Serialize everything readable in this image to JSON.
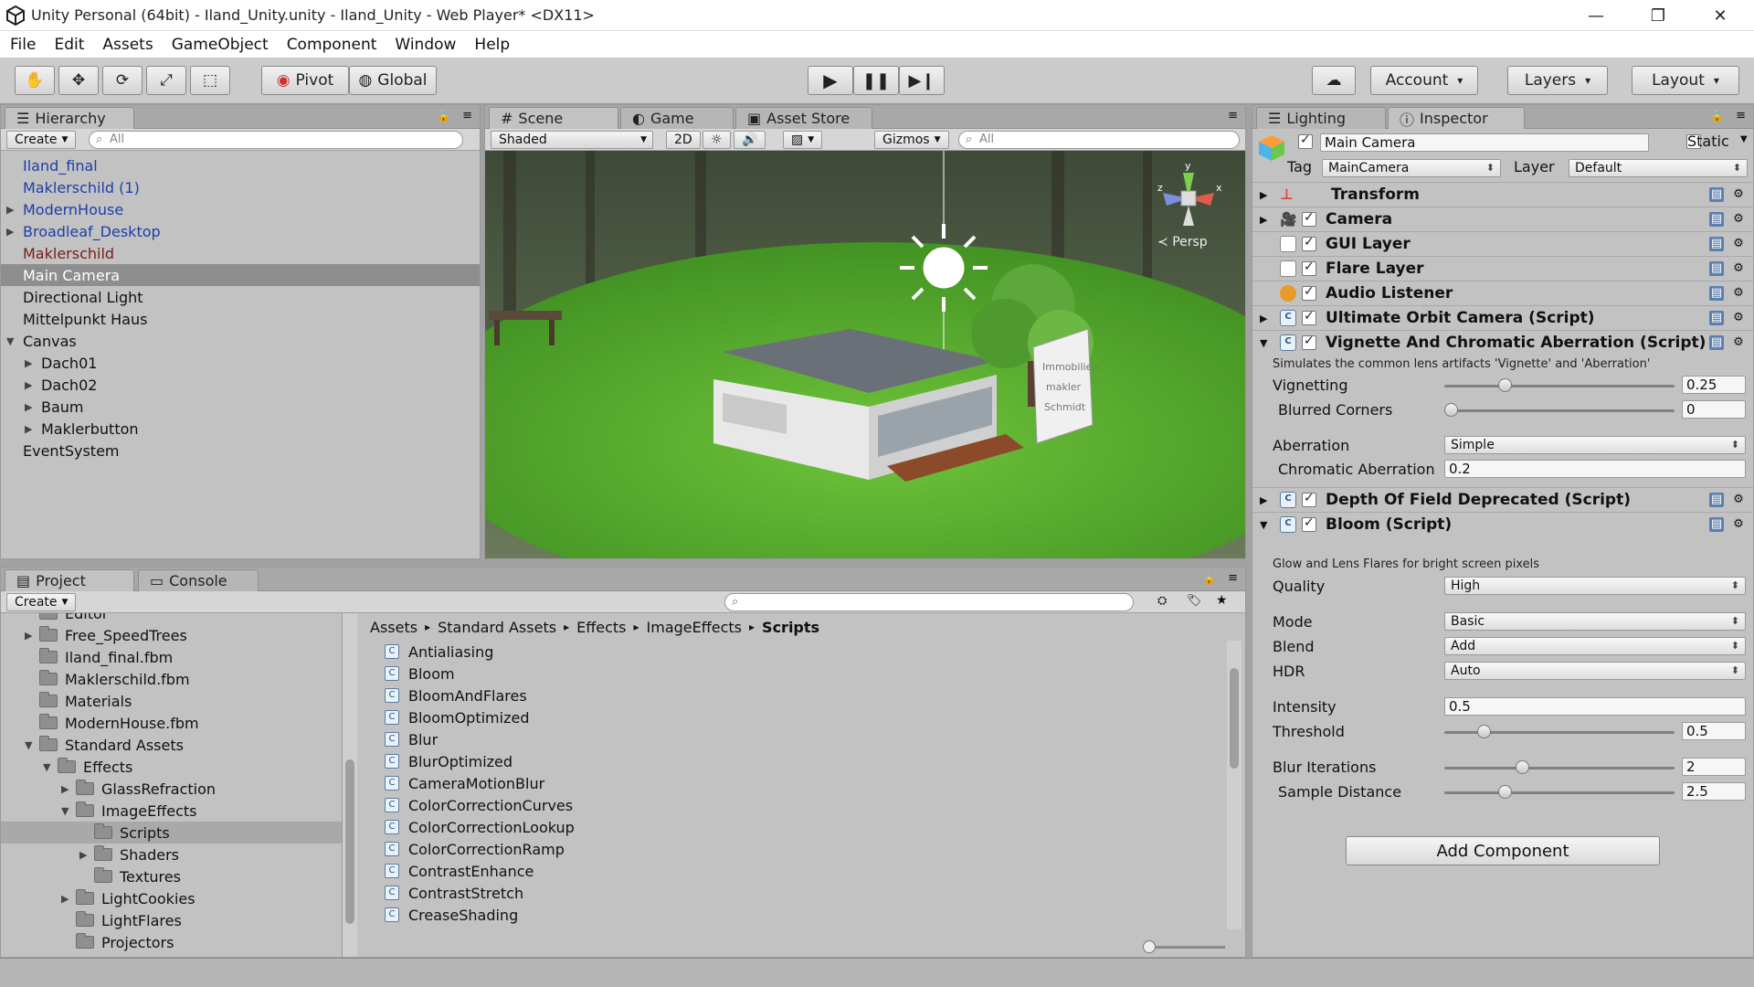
{
  "window": {
    "title": "Unity Personal (64bit) - Iland_Unity.unity - Iland_Unity - Web Player* <DX11>",
    "minimize": "—",
    "maximize": "❐",
    "close": "✕"
  },
  "menu": [
    "File",
    "Edit",
    "Assets",
    "GameObject",
    "Component",
    "Window",
    "Help"
  ],
  "toolbar": {
    "pivot": "Pivot",
    "global": "Global",
    "account": "Account",
    "layers": "Layers",
    "layout": "Layout"
  },
  "hierarchy": {
    "tab": "Hierarchy",
    "create": "Create",
    "search_placeholder": "All",
    "items": [
      {
        "label": "Iland_final",
        "style": "blue",
        "indent": 0,
        "expander": ""
      },
      {
        "label": "Maklerschild (1)",
        "style": "blue",
        "indent": 0,
        "expander": ""
      },
      {
        "label": "ModernHouse",
        "style": "blue",
        "indent": 0,
        "expander": "▶"
      },
      {
        "label": "Broadleaf_Desktop",
        "style": "blue",
        "indent": 0,
        "expander": "▶"
      },
      {
        "label": "Maklerschild",
        "style": "red",
        "indent": 0,
        "expander": ""
      },
      {
        "label": "Main Camera",
        "style": "sel",
        "indent": 0,
        "expander": ""
      },
      {
        "label": "Directional Light",
        "style": "",
        "indent": 0,
        "expander": ""
      },
      {
        "label": "Mittelpunkt Haus",
        "style": "",
        "indent": 0,
        "expander": ""
      },
      {
        "label": "Canvas",
        "style": "",
        "indent": 0,
        "expander": "▼"
      },
      {
        "label": "Dach01",
        "style": "",
        "indent": 1,
        "expander": "▶"
      },
      {
        "label": "Dach02",
        "style": "",
        "indent": 1,
        "expander": "▶"
      },
      {
        "label": "Baum",
        "style": "",
        "indent": 1,
        "expander": "▶"
      },
      {
        "label": "Maklerbutton",
        "style": "",
        "indent": 1,
        "expander": "▶"
      },
      {
        "label": "EventSystem",
        "style": "",
        "indent": 0,
        "expander": ""
      }
    ]
  },
  "scene": {
    "tabs": [
      "Scene",
      "Game",
      "Asset Store"
    ],
    "shading": "Shaded",
    "mode2d": "2D",
    "gizmos": "Gizmos",
    "search_placeholder": "All",
    "persp": "Persp",
    "axis_y": "y",
    "axis_x": "x",
    "axis_z": "z",
    "sign_text": [
      "Immobilien",
      "makler",
      "Schmidt"
    ]
  },
  "project": {
    "tabs": [
      "Project",
      "Console"
    ],
    "create": "Create",
    "tree": [
      {
        "label": "Editor",
        "indent": 0,
        "expander": ""
      },
      {
        "label": "Free_SpeedTrees",
        "indent": 0,
        "expander": "▶"
      },
      {
        "label": "Iland_final.fbm",
        "indent": 0,
        "expander": ""
      },
      {
        "label": "Maklerschild.fbm",
        "indent": 0,
        "expander": ""
      },
      {
        "label": "Materials",
        "indent": 0,
        "expander": ""
      },
      {
        "label": "ModernHouse.fbm",
        "indent": 0,
        "expander": ""
      },
      {
        "label": "Standard Assets",
        "indent": 0,
        "expander": "▼"
      },
      {
        "label": "Effects",
        "indent": 1,
        "expander": "▼"
      },
      {
        "label": "GlassRefraction",
        "indent": 2,
        "expander": "▶"
      },
      {
        "label": "ImageEffects",
        "indent": 2,
        "expander": "▼"
      },
      {
        "label": "Scripts",
        "indent": 3,
        "expander": ""
      },
      {
        "label": "Shaders",
        "indent": 3,
        "expander": "▶"
      },
      {
        "label": "Textures",
        "indent": 3,
        "expander": ""
      },
      {
        "label": "LightCookies",
        "indent": 2,
        "expander": "▶"
      },
      {
        "label": "LightFlares",
        "indent": 2,
        "expander": ""
      },
      {
        "label": "Projectors",
        "indent": 2,
        "expander": ""
      }
    ],
    "breadcrumb": [
      "Assets",
      "Standard Assets",
      "Effects",
      "ImageEffects",
      "Scripts"
    ],
    "files": [
      "Antialiasing",
      "Bloom",
      "BloomAndFlares",
      "BloomOptimized",
      "Blur",
      "BlurOptimized",
      "CameraMotionBlur",
      "ColorCorrectionCurves",
      "ColorCorrectionLookup",
      "ColorCorrectionRamp",
      "ContrastEnhance",
      "ContrastStretch",
      "CreaseShading"
    ]
  },
  "inspector": {
    "tabs": [
      "Lighting",
      "Inspector"
    ],
    "object_name": "Main Camera",
    "static_label": "Static",
    "tag_label": "Tag",
    "tag_value": "MainCamera",
    "layer_label": "Layer",
    "layer_value": "Default",
    "components": {
      "transform": "Transform",
      "camera": "Camera",
      "gui_layer": "GUI Layer",
      "flare_layer": "Flare Layer",
      "audio_listener": "Audio Listener",
      "orbit": "Ultimate Orbit Camera (Script)",
      "vignette": "Vignette And Chromatic Aberration (Script)",
      "dof": "Depth Of Field Deprecated (Script)",
      "bloom": "Bloom (Script)"
    },
    "vignette_desc": "Simulates the common lens artifacts 'Vignette' and 'Aberration'",
    "vignetting": {
      "label": "Vignetting",
      "value": "0.25",
      "fraction": 0.25
    },
    "blurred_corners": {
      "label": "Blurred Corners",
      "value": "0",
      "fraction": 0
    },
    "aberration": {
      "label": "Aberration",
      "value": "Simple"
    },
    "chromatic": {
      "label": "Chromatic Aberration",
      "value": "0.2"
    },
    "bloom_desc": "Glow and Lens Flares for bright screen pixels",
    "quality": {
      "label": "Quality",
      "value": "High"
    },
    "mode": {
      "label": "Mode",
      "value": "Basic"
    },
    "blend": {
      "label": "Blend",
      "value": "Add"
    },
    "hdr": {
      "label": "HDR",
      "value": "Auto"
    },
    "intensity": {
      "label": "Intensity",
      "value": "0.5"
    },
    "threshold": {
      "label": "Threshold",
      "value": "0.5",
      "fraction": 0.15
    },
    "blur_iterations": {
      "label": "Blur Iterations",
      "value": "2",
      "fraction": 0.33
    },
    "sample_distance": {
      "label": "Sample Distance",
      "value": "2.5",
      "fraction": 0.25
    },
    "add_component": "Add Component"
  }
}
